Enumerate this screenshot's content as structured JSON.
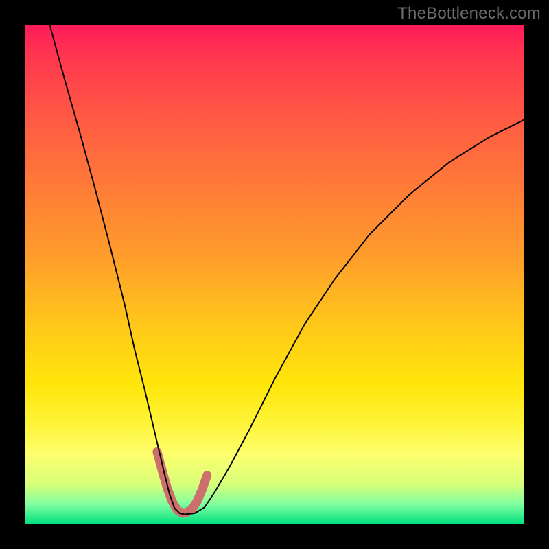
{
  "watermark": "TheBottleneck.com",
  "chart_data": {
    "type": "line",
    "title": "",
    "xlabel": "",
    "ylabel": "",
    "xlim": [
      0,
      100
    ],
    "ylim": [
      0,
      100
    ],
    "grid": false,
    "legend": false,
    "series": [
      {
        "name": "main-curve",
        "color": "#000000",
        "stroke_width": 2,
        "x": [
          5,
          8,
          11,
          14,
          17,
          20,
          22,
          24,
          26,
          28,
          29,
          30,
          31,
          32,
          34,
          36,
          38,
          41,
          45,
          50,
          56,
          62,
          69,
          77,
          85,
          93,
          100
        ],
        "values": [
          100,
          89,
          78.5,
          67.5,
          56,
          44,
          35,
          27,
          18.5,
          10,
          6,
          3.2,
          2.2,
          2.0,
          2.2,
          3.4,
          6.4,
          11.5,
          19,
          29,
          40,
          49,
          58,
          66,
          72.5,
          77.5,
          81
        ]
      },
      {
        "name": "lower-highlight",
        "color": "#cc6f6d",
        "stroke_width": 13,
        "x": [
          26.5,
          27.5,
          28.5,
          29.5,
          30.5,
          31.5,
          32.5,
          33.5,
          34.5,
          35.5,
          36.5
        ],
        "values": [
          14.5,
          10.8,
          7.3,
          4.6,
          2.9,
          2.2,
          2.4,
          3.1,
          4.6,
          6.9,
          9.8
        ]
      }
    ]
  }
}
